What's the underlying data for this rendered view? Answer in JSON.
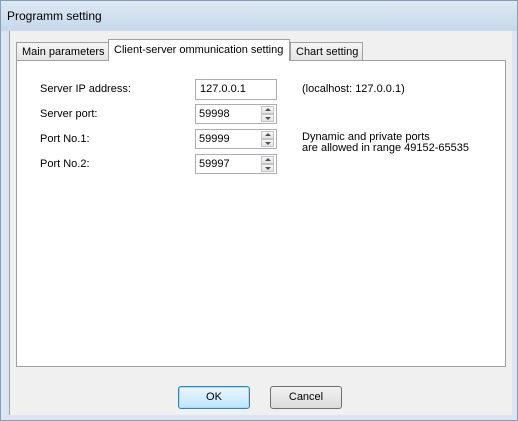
{
  "window": {
    "title": "Programm setting"
  },
  "tabs": [
    {
      "label": "Main parameters",
      "active": false
    },
    {
      "label": "Client-server ommunication setting",
      "active": true
    },
    {
      "label": "Chart setting",
      "active": false
    }
  ],
  "form": {
    "server_ip": {
      "label": "Server IP address:",
      "value": "127.0.0.1",
      "hint": "(localhost: 127.0.0.1)"
    },
    "server_port": {
      "label": "Server port:",
      "value": "59998"
    },
    "port1": {
      "label": "Port No.1:",
      "value": "59999"
    },
    "port2": {
      "label": "Port No.2:",
      "value": "59997"
    },
    "ports_hint_line1": "Dynamic and private ports",
    "ports_hint_line2": "are allowed in range 49152-65535"
  },
  "buttons": {
    "ok": "OK",
    "cancel": "Cancel"
  },
  "icons": {
    "spin_up": "spin-up-arrow-icon",
    "spin_down": "spin-down-arrow-icon"
  }
}
